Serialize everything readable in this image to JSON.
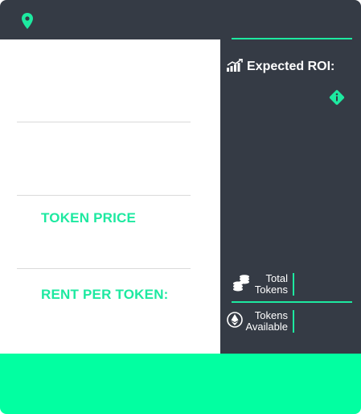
{
  "header": {
    "location_icon": "map-pin-icon"
  },
  "left": {
    "token_price_label": "TOKEN PRICE",
    "rent_per_token_label": "RENT PER TOKEN:"
  },
  "right": {
    "roi_label": "Expected ROI:",
    "roi_icon": "bar-chart-up-icon",
    "info_icon": "info-icon",
    "total_tokens_line1": "Total",
    "total_tokens_line2": "Tokens",
    "tokens_available_line1": "Tokens",
    "tokens_available_line2": "Available"
  },
  "colors": {
    "dark": "#353b45",
    "accent": "#1de9a0",
    "footer": "#02ffa1"
  }
}
